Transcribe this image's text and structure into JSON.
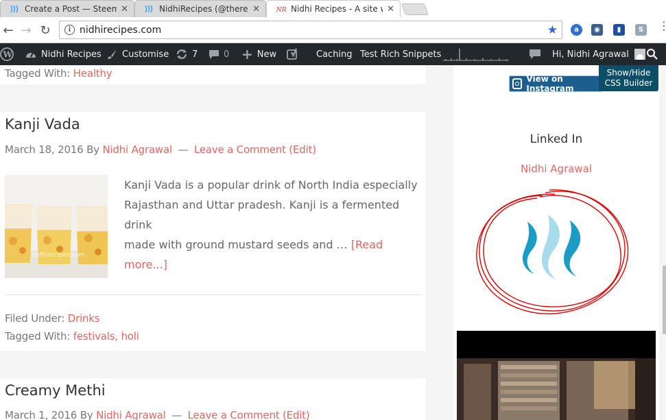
{
  "browser": {
    "tabs": [
      {
        "title": "Create a Post — Steemit",
        "active": false
      },
      {
        "title": "NidhiRecipes (@therebo",
        "active": false
      },
      {
        "title": "Nidhi Recipes - A site wit",
        "active": true
      }
    ],
    "url": "nidhirecipes.com"
  },
  "adminbar": {
    "site_name": "Nidhi Recipes",
    "customise": "Customise",
    "updates_count": "7",
    "comments_count": "0",
    "new_label": "New",
    "caching": "Caching",
    "rich_snippets": "Test Rich Snippets",
    "greeting": "Hi, Nidhi Agrawal"
  },
  "posts": [
    {
      "tagged_label": "Tagged With:",
      "tags": "Healthy"
    },
    {
      "title": "Kanji Vada",
      "date": "March 18, 2016",
      "by": "By",
      "author": "Nidhi Agrawal",
      "sep": "—",
      "comment_link": "Leave a Comment",
      "edit_link": "(Edit)",
      "excerpt_lines": [
        "Kanji Vada is a popular drink of North India especially",
        "Rajasthan and Uttar pradesh. Kanji is a fermented drink",
        "made with ground mustard seeds and …"
      ],
      "read_more": "[Read more...]",
      "filed_label": "Filed Under:",
      "category": "Drinks",
      "tagged_label": "Tagged With:",
      "tags": "festivals, holi",
      "thumb_watermark": "nidhirecipes.com"
    },
    {
      "title": "Creamy Methi",
      "date": "March 1, 2016",
      "by": "By",
      "author": "Nidhi Agrawal",
      "sep": "—",
      "comment_link": "Leave a Comment",
      "edit_link": "(Edit)"
    }
  ],
  "sidebar": {
    "instagram_button": "View on Instagram",
    "css_builder": [
      "Show/Hide",
      "CSS Builder"
    ],
    "linkedin_title": "Linked In",
    "linkedin_link": "Nidhi Agrawal"
  },
  "colors": {
    "link": "#e0665f",
    "adminbar": "#23282d",
    "steem_dark": "#1a9cc4",
    "steem_light": "#a8dcec",
    "annotation": "#e00000"
  }
}
